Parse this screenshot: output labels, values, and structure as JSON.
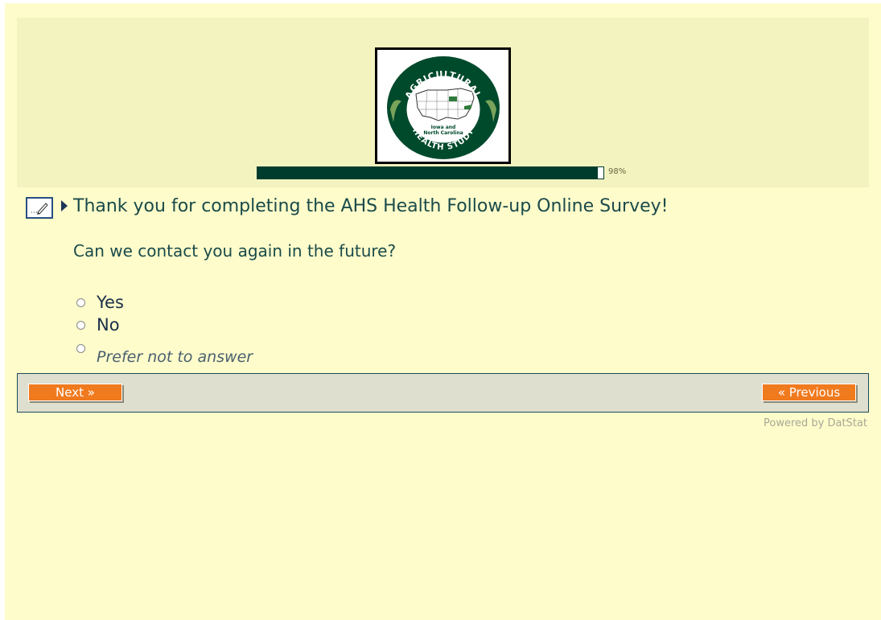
{
  "header": {
    "logo": {
      "top_text": "AGRICULTURAL",
      "bottom_text": "HEALTH STUDY",
      "center_text_line1": "Iowa and",
      "center_text_line2": "North Carolina"
    },
    "progress": {
      "percent": 98,
      "label": "98%"
    }
  },
  "main": {
    "thank_you": "Thank you for completing the AHS Health Follow-up Online Survey!",
    "question": "Can we contact you again in the future?",
    "options": [
      {
        "label": "Yes"
      },
      {
        "label": "No"
      },
      {
        "label": "Prefer not to answer"
      }
    ]
  },
  "nav": {
    "next_label": "Next »",
    "previous_label": "« Previous"
  },
  "footer": {
    "powered_by": "Powered by DatStat"
  },
  "colors": {
    "page_bg": "#fefcca",
    "header_bg": "#f3f3bf",
    "progress": "#003c2e",
    "button": "#f07a1e",
    "text": "#1a4a4a"
  },
  "icons": {
    "edit": "edit-note-icon",
    "arrow": "play-arrow-icon"
  }
}
